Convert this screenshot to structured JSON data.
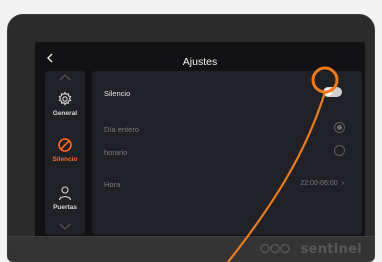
{
  "header": {
    "back_icon": "chevron-left-icon",
    "title": "Ajustes"
  },
  "sidebar": {
    "items": [
      {
        "label": "General",
        "icon": "gear-icon",
        "active": false
      },
      {
        "label": "Silencio",
        "icon": "prohibited-icon",
        "active": true
      },
      {
        "label": "Puertas",
        "icon": "person-icon",
        "active": false
      }
    ]
  },
  "settings": {
    "silencio": {
      "label": "Silencio",
      "toggle_on": false
    },
    "dia_entero": {
      "label": "Día entero",
      "selected": true
    },
    "horario": {
      "label": "horario",
      "selected": false
    },
    "hora": {
      "label": "Hora",
      "value": "22:00-06:00"
    }
  },
  "brand": "sentinel",
  "colors": {
    "accent": "#ff6a1a",
    "screen_bg": "#121214",
    "panel_bg": "#202126"
  }
}
